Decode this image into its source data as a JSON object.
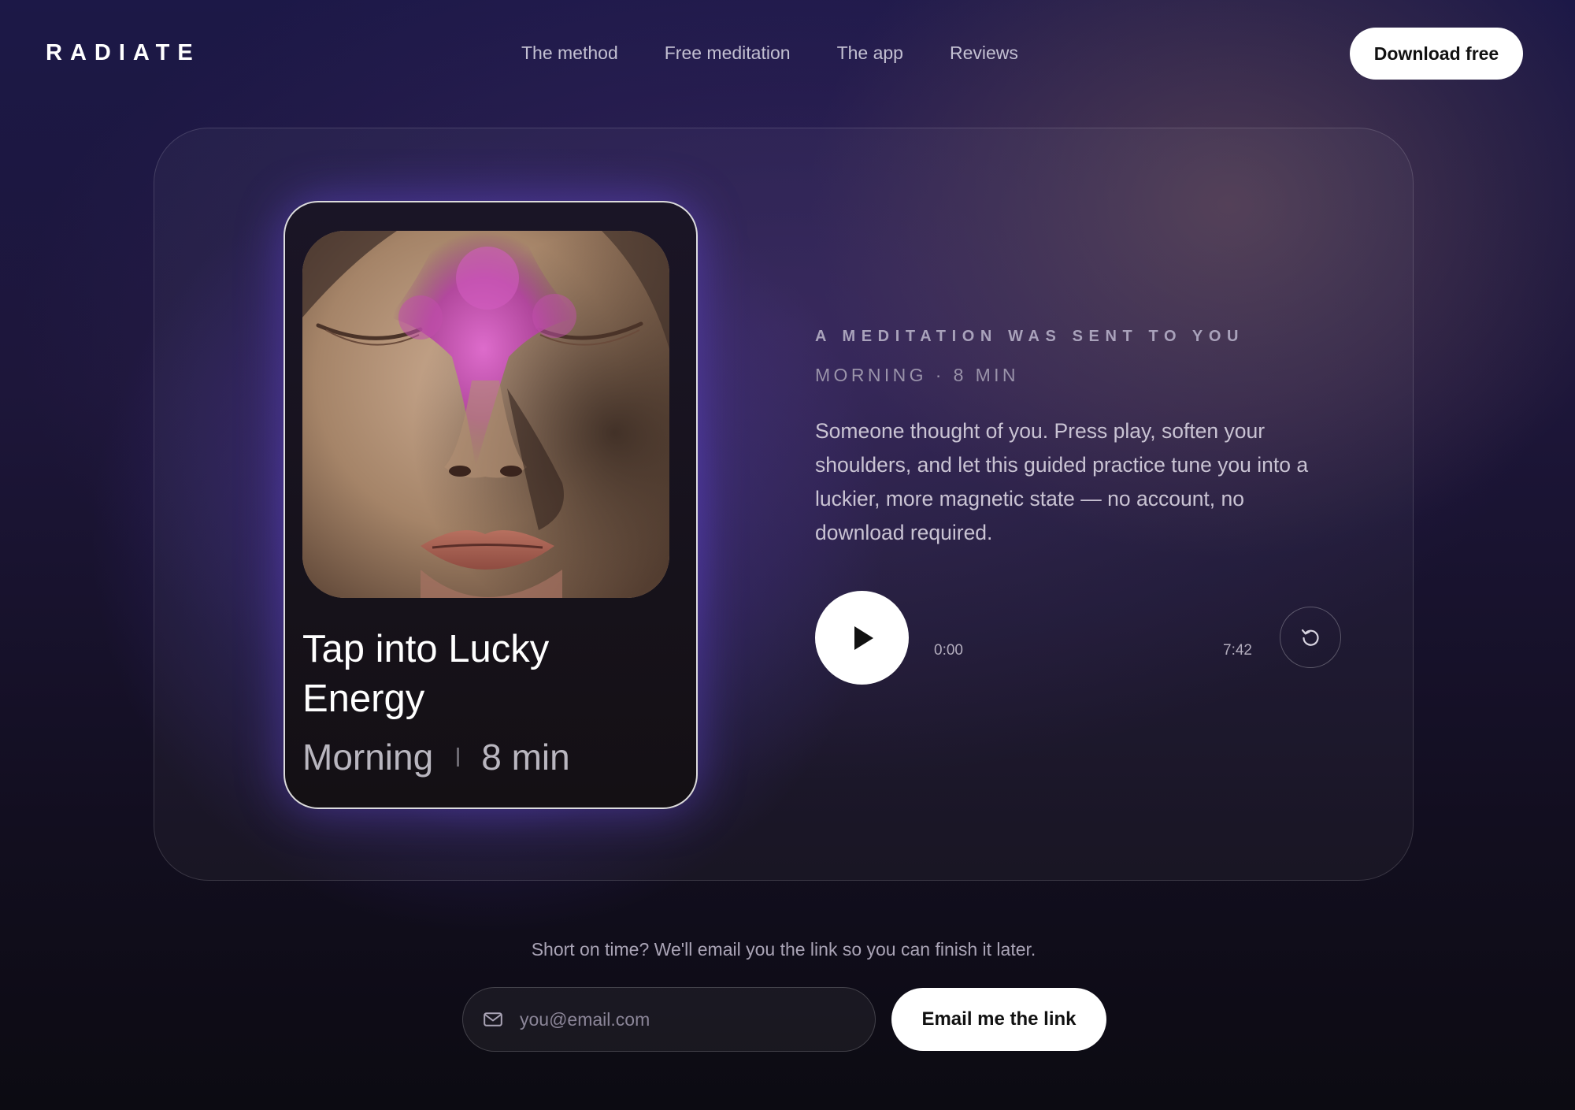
{
  "header": {
    "logo": "RADIATE",
    "nav": [
      {
        "label": "The method"
      },
      {
        "label": "Free meditation"
      },
      {
        "label": "The app"
      },
      {
        "label": "Reviews"
      }
    ],
    "cta_label": "Download free"
  },
  "track": {
    "title": "Tap into Lucky Energy",
    "time_of_day": "Morning",
    "duration": "8 min"
  },
  "intro": {
    "eyebrow": "A MEDITATION WAS SENT TO YOU",
    "subline": "MORNING · 8 MIN",
    "description": "Someone thought of you. Press play, soften your shoulders, and let this guided practice tune you into a luckier, more magnetic state — no account, no download required."
  },
  "player": {
    "current_time": "0:00",
    "total_time": "7:42",
    "play_icon": "play-icon",
    "replay_icon": "replay-icon"
  },
  "email_capture": {
    "prompt": "Short on time? We'll email you the link so you can finish it later.",
    "placeholder": "you@email.com",
    "value": "",
    "button_label": "Email me the link",
    "icon": "mail-icon"
  },
  "colors": {
    "background_top": "#1c1847",
    "background_bottom": "#0c0b12",
    "accent_glow": "#6040e6",
    "button_bg": "#ffffff",
    "button_text": "#111111"
  }
}
